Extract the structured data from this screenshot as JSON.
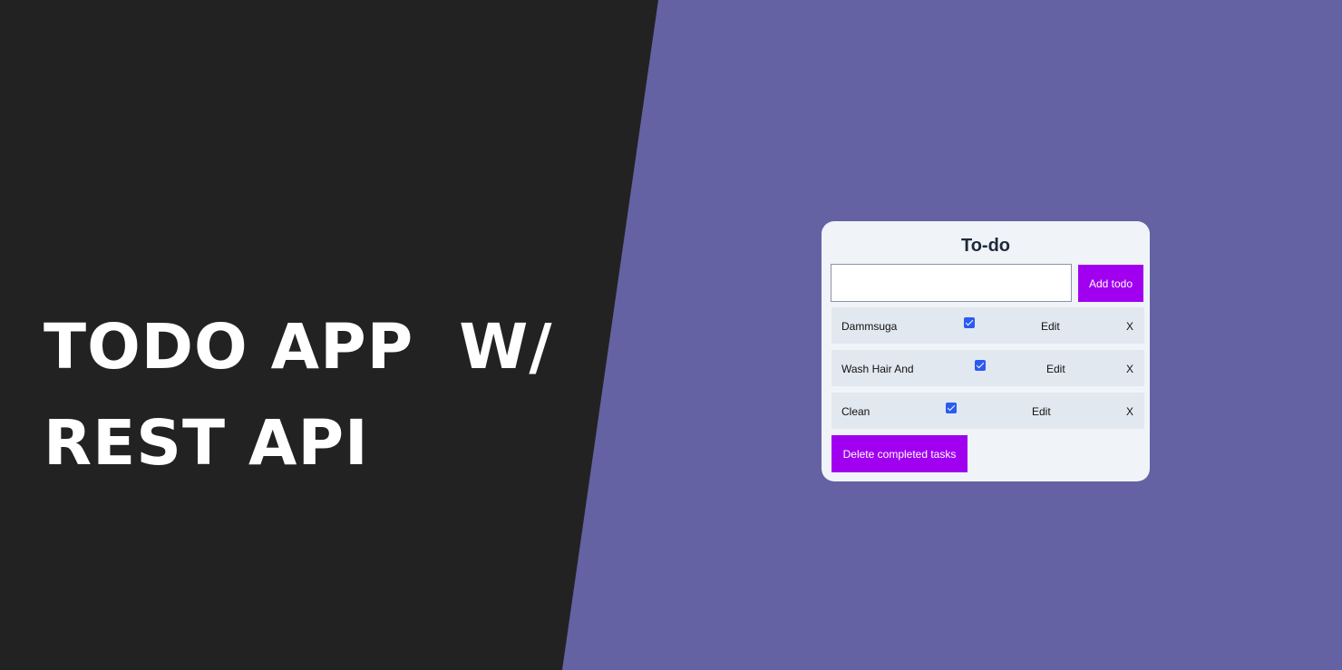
{
  "headline": {
    "line1": "TODO APP  W/",
    "line2": "REST API"
  },
  "colors": {
    "left_panel": "#222222",
    "right_panel": "#6462a3",
    "card": "#f0f4f8",
    "row": "#e2e8f0",
    "accent_button": "#a100f0",
    "checkbox": "#2b5bf0"
  },
  "todo_app": {
    "title": "To-do",
    "input": {
      "value": "",
      "placeholder": ""
    },
    "add_button": "Add todo",
    "todos": [
      {
        "text": "Dammsuga",
        "completed": true,
        "edit_label": "Edit",
        "delete_label": "X"
      },
      {
        "text": "Wash Hair And",
        "completed": true,
        "edit_label": "Edit",
        "delete_label": "X"
      },
      {
        "text": "Clean",
        "completed": true,
        "edit_label": "Edit",
        "delete_label": "X"
      }
    ],
    "delete_completed_button": "Delete completed tasks"
  }
}
